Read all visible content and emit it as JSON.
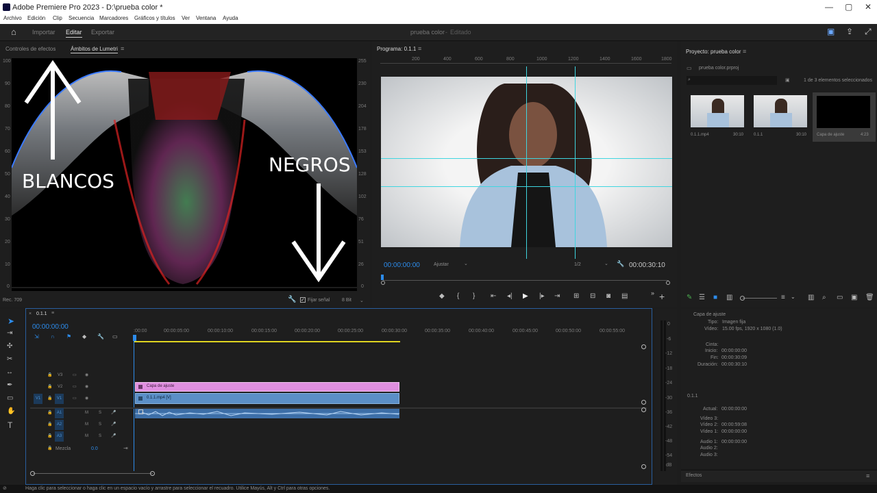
{
  "window": {
    "title": "Adobe Premiere Pro 2023 - D:\\prueba color *",
    "min": "—",
    "max": "▢",
    "close": "✕"
  },
  "menu": [
    "Archivo",
    "Edición",
    "Clip",
    "Secuencia",
    "Marcadores",
    "Gráficos y títulos",
    "Ver",
    "Ventana",
    "Ayuda"
  ],
  "workspace": {
    "tabs": [
      "Importar",
      "Editar",
      "Exportar"
    ],
    "active": "Editar",
    "project_title": "prueba color",
    "status": "Editado"
  },
  "scopes": {
    "tab1": "Controles de efectos",
    "tab2": "Ámbitos de Lumetri",
    "left_scale": [
      "100",
      "90",
      "80",
      "70",
      "60",
      "50",
      "40",
      "30",
      "20",
      "10",
      "0"
    ],
    "right_scale": [
      "255",
      "230",
      "204",
      "178",
      "153",
      "128",
      "102",
      "76",
      "51",
      "26",
      "0"
    ],
    "footer_left": "Rec. 709",
    "footer_lock": "Fijar señal",
    "footer_bits": "8 Bit"
  },
  "annotations": {
    "blancos": "BLANCOS",
    "negros": "NEGROS"
  },
  "program": {
    "title": "Programa: 0.1.1",
    "ruler": [
      "200",
      "400",
      "600",
      "800",
      "1000",
      "1200",
      "1400",
      "1600",
      "1800"
    ],
    "timecode": "00:00:00:00",
    "fit": "Ajustar",
    "resolution": "1/2",
    "duration": "00:00:30:10"
  },
  "project": {
    "title": "Proyecto: prueba color",
    "file": "prueba color.prproj",
    "selection": "1 de 3 elementos seleccionados",
    "items": [
      {
        "name": "0.1.1.mp4",
        "dur": "30:10"
      },
      {
        "name": "0.1.1",
        "dur": "30:10"
      },
      {
        "name": "Capa de ajuste",
        "dur": "4:23"
      }
    ]
  },
  "info": {
    "name": "Capa de ajuste",
    "tipo_label": "Tipo:",
    "tipo": "Imagen fija",
    "video_label": "Vídeo:",
    "video": "15.00 fps, 1920 x 1080 (1.0)",
    "cinta_label": "Cinta:",
    "inicio_label": "Inicio:",
    "inicio": "00:00:00:00",
    "fin_label": "Fin:",
    "fin": "00:00:30:09",
    "duracion_label": "Duración:",
    "duracion": "00:00:30:10",
    "seq": "0.1.1",
    "actual_label": "Actual:",
    "actual": "00:00:00:00",
    "v3": "Vídeo 3:",
    "v2": "Vídeo 2:",
    "v2val": "00:00:59:08",
    "v1": "Vídeo 1:",
    "v1val": "00:00:00:00",
    "a1": "Audio 1:",
    "a1val": "00:00:00:00",
    "a2": "Audio 2:",
    "a3": "Audio 3:",
    "effects": "Efectos"
  },
  "timeline": {
    "seq": "0.1.1",
    "timecode": "00:00:00:00",
    "ruler": [
      ":00:00",
      "00:00:05:00",
      "00:00:10:00",
      "00:00:15:00",
      "00:00:20:00",
      "00:00:25:00",
      "00:00:30:00",
      "00:00:35:00",
      "00:00:40:00",
      "00:00:45:00",
      "00:00:50:00",
      "00:00:55:00"
    ],
    "tracks": [
      "V3",
      "V2",
      "V1",
      "A1",
      "A2",
      "A3"
    ],
    "src_v": "V1",
    "src_a": "A1",
    "m": "M",
    "s": "S",
    "mix_label": "Mezcla",
    "mix_val": "0.0",
    "clip_adj": "Capa de ajuste",
    "clip_video": "0.1.1.mp4 [V]"
  },
  "meter": [
    "0",
    "-6",
    "-12",
    "-18",
    "-24",
    "-30",
    "-36",
    "-42",
    "-48",
    "-54",
    "dB"
  ],
  "status": "Haga clic para seleccionar o haga clic en un espacio vacío y arrastre para seleccionar el recuadro. Utilice Mayús, Alt y Ctrl para otras opciones.",
  "colors": {
    "accent": "#2d8ceb",
    "adjust_clip": "#e08fe0",
    "video_clip": "#5b8fc7",
    "audio_clip": "#3d6fa8",
    "guide": "#3fd6e0"
  }
}
